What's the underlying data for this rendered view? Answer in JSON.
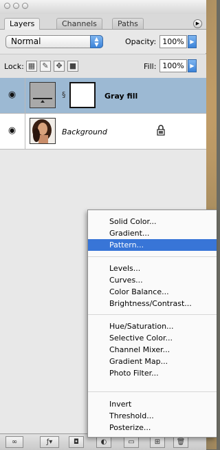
{
  "panel": {
    "tabs": [
      {
        "label": "Layers",
        "active": true
      },
      {
        "label": "Channels",
        "active": false
      },
      {
        "label": "Paths",
        "active": false
      }
    ],
    "blend_mode": "Normal",
    "opacity_label": "Opacity:",
    "opacity_value": "100%",
    "lock_label": "Lock:",
    "fill_label": "Fill:",
    "fill_value": "100%"
  },
  "layers": [
    {
      "name": "Gray fill",
      "selected": true,
      "visible": true
    },
    {
      "name": "Background",
      "selected": false,
      "visible": true,
      "locked": true
    }
  ],
  "popup_menu": {
    "items": [
      {
        "label": "Solid Color...",
        "highlighted": false
      },
      {
        "label": "Gradient...",
        "highlighted": false
      },
      {
        "label": "Pattern...",
        "highlighted": true
      },
      {
        "label": "Levels...",
        "highlighted": false
      },
      {
        "label": "Curves...",
        "highlighted": false
      },
      {
        "label": "Color Balance...",
        "highlighted": false
      },
      {
        "label": "Brightness/Contrast...",
        "highlighted": false
      },
      {
        "label": "Hue/Saturation...",
        "highlighted": false
      },
      {
        "label": "Selective Color...",
        "highlighted": false
      },
      {
        "label": "Channel Mixer...",
        "highlighted": false
      },
      {
        "label": "Gradient Map...",
        "highlighted": false
      },
      {
        "label": "Photo Filter...",
        "highlighted": false
      },
      {
        "label": "Invert",
        "highlighted": false
      },
      {
        "label": "Threshold...",
        "highlighted": false
      },
      {
        "label": "Posterize...",
        "highlighted": false
      }
    ]
  },
  "icons": {
    "eye": "eye-icon",
    "link": "link-icon",
    "lock": "lock-icon",
    "menu": "panel-menu-icon"
  },
  "colors": {
    "selected_layer": "#9cb9d3",
    "menu_highlight": "#3875d7",
    "aqua_blue": "#3b83d9"
  }
}
